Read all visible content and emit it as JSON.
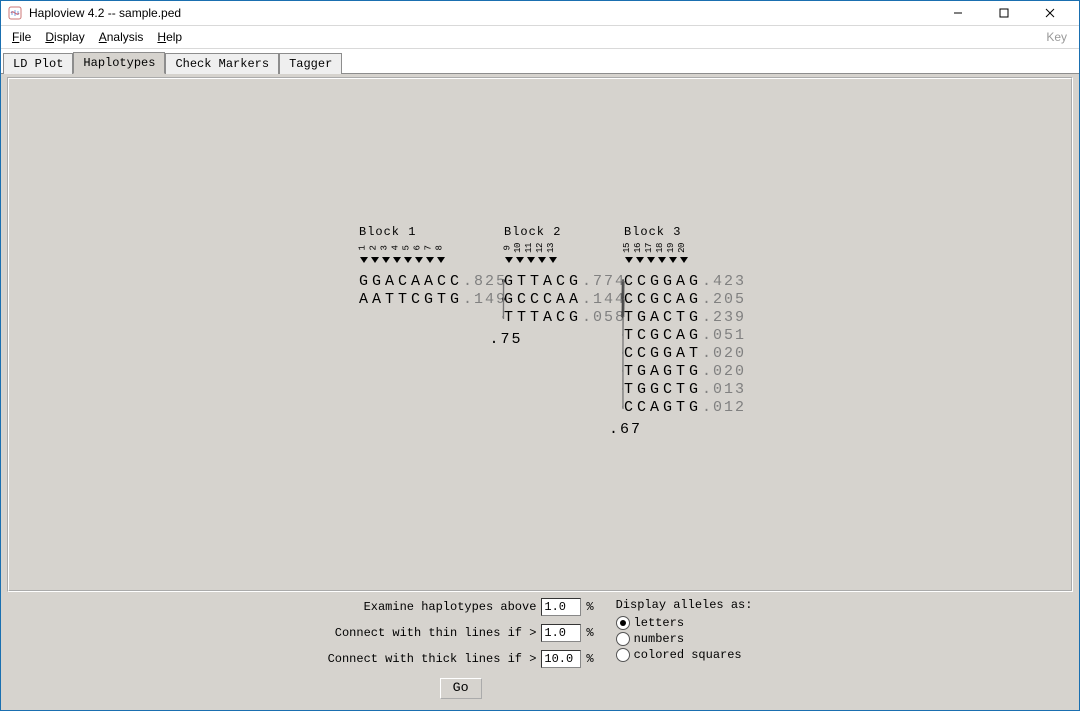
{
  "window": {
    "title": "Haploview 4.2 -- sample.ped",
    "min_label": "–",
    "max_label": "☐",
    "close_label": "✕"
  },
  "menu": {
    "file": "File",
    "display": "Display",
    "analysis": "Analysis",
    "help": "Help",
    "key": "Key"
  },
  "tabs": {
    "ldplot": "LD Plot",
    "haplotypes": "Haplotypes",
    "check": "Check Markers",
    "tagger": "Tagger",
    "active": "haplotypes"
  },
  "blocks": [
    {
      "label": "Block 1",
      "markers": [
        "1",
        "2",
        "3",
        "4",
        "5",
        "6",
        "7",
        "8"
      ],
      "haplotypes": [
        {
          "alleles": "GGACAACC",
          "freq": ".825"
        },
        {
          "alleles": "AATTCGTG",
          "freq": ".149"
        }
      ]
    },
    {
      "label": "Block 2",
      "markers": [
        "9",
        "10",
        "11",
        "12",
        "13"
      ],
      "haplotypes": [
        {
          "alleles": "GTTACG",
          "freq": ".774"
        },
        {
          "alleles": "GCCCAA",
          "freq": ".144"
        },
        {
          "alleles": "TTTACG",
          "freq": ".058"
        }
      ]
    },
    {
      "label": "Block 3",
      "markers": [
        "15",
        "16",
        "17",
        "18",
        "19",
        "20"
      ],
      "haplotypes": [
        {
          "alleles": "CCGGAG",
          "freq": ".423"
        },
        {
          "alleles": "CCGCAG",
          "freq": ".205"
        },
        {
          "alleles": "TGACTG",
          "freq": ".239"
        },
        {
          "alleles": "TCGCAG",
          "freq": ".051"
        },
        {
          "alleles": "CCGGAT",
          "freq": ".020"
        },
        {
          "alleles": "TGAGTG",
          "freq": ".020"
        },
        {
          "alleles": "TGGCTG",
          "freq": ".013"
        },
        {
          "alleles": "CCAGTG",
          "freq": ".012"
        }
      ]
    }
  ],
  "multiallelic_d": {
    "b1_b2": ".75",
    "b2_b3": ".67"
  },
  "controls": {
    "examine_label": "Examine haplotypes above",
    "examine_value": "1.0",
    "thin_label": "Connect with thin lines if >",
    "thin_value": "1.0",
    "thick_label": "Connect with thick lines if >",
    "thick_value": "10.0",
    "percent": "%",
    "display_label": "Display alleles as:",
    "opt_letters": "letters",
    "opt_numbers": "numbers",
    "opt_squares": "colored squares",
    "selected": "letters",
    "go": "Go"
  }
}
